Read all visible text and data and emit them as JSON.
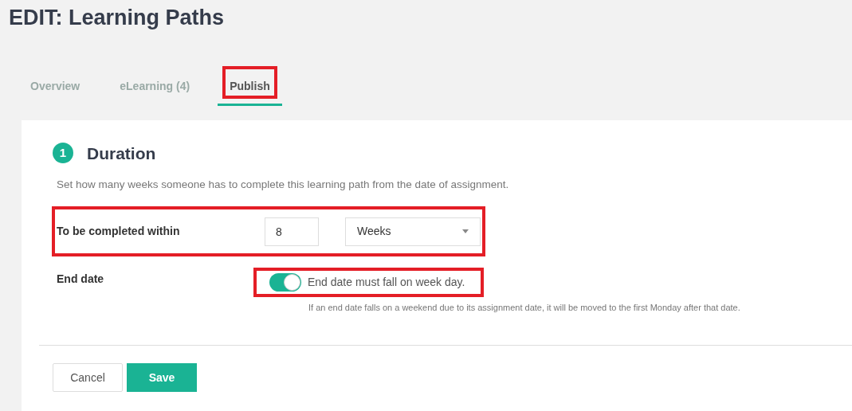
{
  "page_title": "EDIT: Learning Paths",
  "tabs": [
    {
      "label": "Overview",
      "selected": false,
      "highlighted": false
    },
    {
      "label": "eLearning (4)",
      "selected": false,
      "highlighted": false
    },
    {
      "label": "Publish",
      "selected": true,
      "highlighted": true
    }
  ],
  "section": {
    "number": "1",
    "title": "Duration",
    "description": "Set how many weeks someone has to complete this learning path from the date of assignment.",
    "duration": {
      "label": "To be completed within",
      "value": "8",
      "unit": "Weeks",
      "highlighted": true
    },
    "end_date": {
      "label": "End date",
      "toggle_label": "End date must fall on week day.",
      "on": true,
      "highlighted": true,
      "hint": "If an end date falls on a weekend due to its assignment date, it will be moved to the first Monday after that date."
    }
  },
  "buttons": [
    {
      "label": "Cancel",
      "kind": "secondary"
    },
    {
      "label": "Save",
      "kind": "primary"
    }
  ]
}
